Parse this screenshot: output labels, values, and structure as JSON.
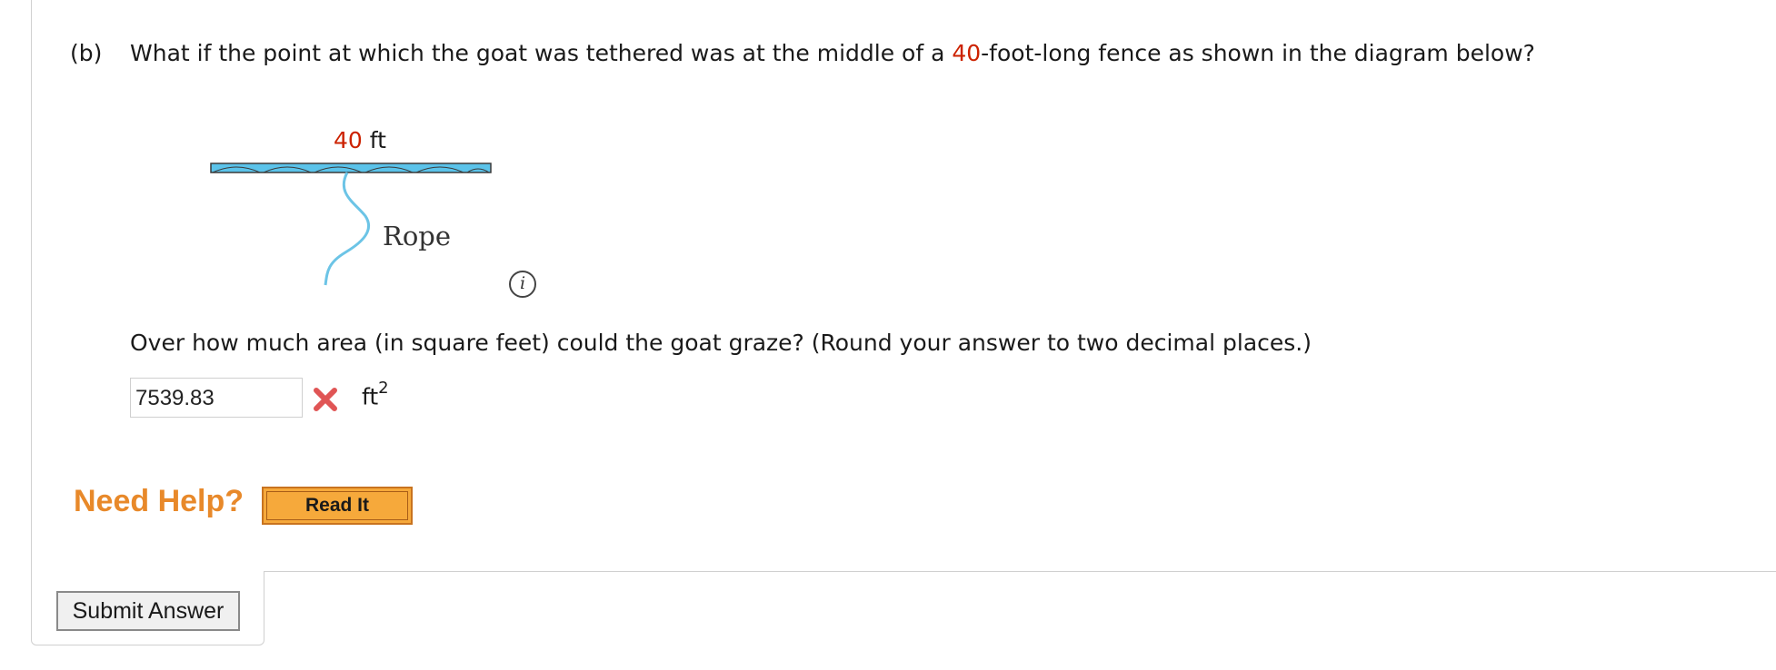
{
  "question": {
    "part": "(b)",
    "text_before": "What if the point at which the goat was tethered was at the middle of a ",
    "highlight": "40",
    "text_after": "-foot-long fence as shown in the diagram below?"
  },
  "diagram": {
    "length_value": "40",
    "length_unit": " ft",
    "rope_label": "Rope",
    "fence_color": "#5bc3ea",
    "rope_color": "#6cc4e6"
  },
  "info_icon": {
    "glyph": "i",
    "icon": "info-icon"
  },
  "prompt": "Over how much area (in square feet) could the goat graze? (Round your answer to two decimal places.)",
  "answer": {
    "value": "7539.83",
    "status": "incorrect",
    "status_icon": "x-mark-icon",
    "unit_base": "ft",
    "unit_exp": "2"
  },
  "help": {
    "label": "Need Help?",
    "read_it_label": "Read It"
  },
  "submit_label": "Submit Answer",
  "colors": {
    "accent_red": "#cc2200",
    "help_orange": "#e8892a",
    "read_it_bg": "#f6a93b"
  }
}
